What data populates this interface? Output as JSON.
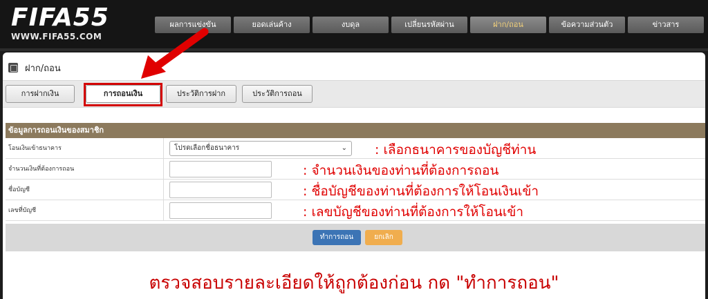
{
  "logo": {
    "main": "FIFA55",
    "sub": "WWW.FIFA55.COM"
  },
  "nav": [
    {
      "label": "ผลการแข่งขัน"
    },
    {
      "label": "ยอดเล่นค้าง"
    },
    {
      "label": "งบดุล"
    },
    {
      "label": "เปลี่ยนรหัสผ่าน"
    },
    {
      "label": "ฝาก/ถอน",
      "active": true
    },
    {
      "label": "ข้อความส่วนตัว"
    },
    {
      "label": "ข่าวสาร"
    }
  ],
  "page": {
    "title": "ฝาก/ถอน"
  },
  "tabs": [
    {
      "label": "การฝากเงิน"
    },
    {
      "label": "การถอนเงิน",
      "active": true
    },
    {
      "label": "ประวัติการฝาก"
    },
    {
      "label": "ประวัติการถอน"
    }
  ],
  "form": {
    "header": "ข้อมูลการถอนเงินของสมาชิก",
    "rows": [
      {
        "label": "โอนเงินเข้าธนาคาร",
        "type": "select",
        "value": "โปรดเลือกชื่อธนาคาร",
        "note": ": เลือกธนาคารของบัญชีท่าน"
      },
      {
        "label": "จำนวนเงินที่ต้องการถอน",
        "type": "input",
        "value": "",
        "note": ": จำนวนเงินของท่านที่ต้องการถอน"
      },
      {
        "label": "ชื่อบัญชี",
        "type": "input",
        "value": "",
        "note": ": ชื่อบัญชีของท่านที่ต้องการให้โอนเงินเข้า"
      },
      {
        "label": "เลขที่บัญชี",
        "type": "input",
        "value": "",
        "note": ": เลขบัญชีของท่านที่ต้องการให้โอนเข้า"
      }
    ],
    "submit_label": "ทำการถอน",
    "cancel_label": "ยกเลิก"
  },
  "instruction": "ตรวจสอบรายละเอียดให้ถูกต้องก่อน กด \"ทำการถอน\"",
  "colors": {
    "header_bg": "#151515",
    "form_header_bg": "#8c7a5d",
    "annotation_red": "#e00000",
    "submit_blue": "#3c74b5",
    "cancel_orange": "#f0ad4e"
  }
}
